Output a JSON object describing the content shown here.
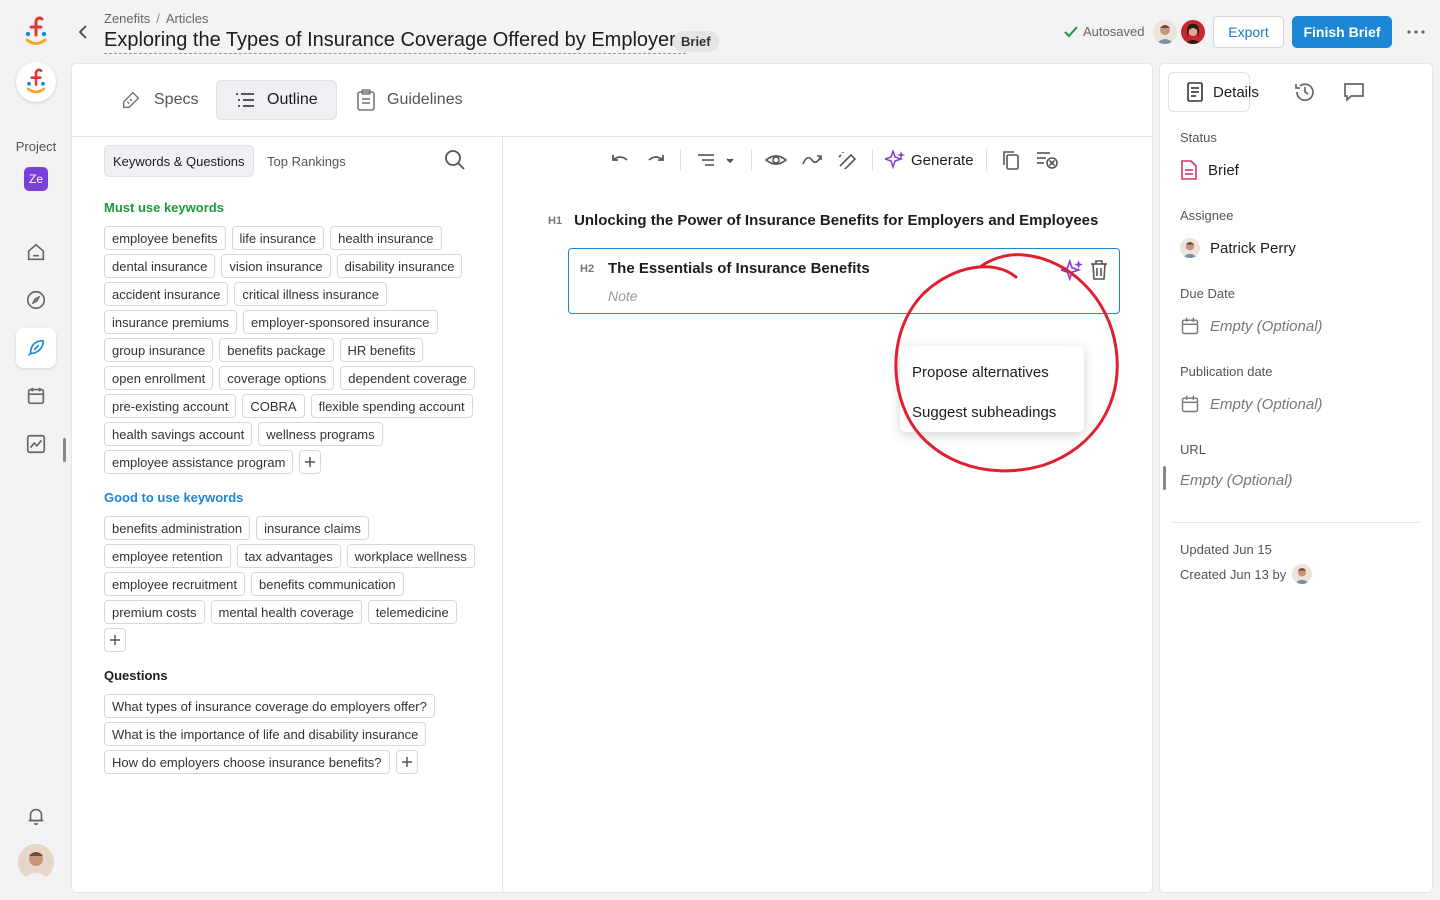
{
  "header": {
    "breadcrumb": [
      "Zenefits",
      "Articles"
    ],
    "breadcrumb_separator": "/",
    "title": "Exploring the Types of Insurance Coverage Offered by Employers",
    "title_badge": "Brief",
    "autosave_label": "Autosaved",
    "export_label": "Export",
    "finish_label": "Finish Brief"
  },
  "rail": {
    "project_label": "Project",
    "project_badge": "Ze",
    "nav_icons": [
      "home-icon",
      "compass-icon",
      "feather-icon",
      "calendar-icon",
      "analytics-icon"
    ],
    "active_nav": "feather-icon"
  },
  "tabs": [
    {
      "label": "Specs",
      "icon": "wrench-icon"
    },
    {
      "label": "Outline",
      "icon": "list-icon",
      "active": true
    },
    {
      "label": "Guidelines",
      "icon": "clipboard-icon"
    }
  ],
  "subtabs": [
    {
      "label": "Keywords & Questions",
      "active": true
    },
    {
      "label": "Top Rankings"
    }
  ],
  "keywords": {
    "must_title": "Must use keywords",
    "must": [
      "employee benefits",
      "life insurance",
      "health insurance",
      "dental insurance",
      "vision insurance",
      "disability insurance",
      "accident insurance",
      "critical illness insurance",
      "insurance premiums",
      "employer-sponsored insurance",
      "group insurance",
      "benefits package",
      "HR benefits",
      "open enrollment",
      "coverage options",
      "dependent coverage",
      "pre-existing account",
      "COBRA",
      "flexible spending account",
      "health savings account",
      "wellness programs",
      "employee assistance program"
    ],
    "good_title": "Good to use keywords",
    "good": [
      "benefits administration",
      "insurance claims",
      "employee retention",
      "tax advantages",
      "workplace wellness",
      "employee recruitment",
      "benefits communication",
      "premium costs",
      "mental health coverage",
      "telemedicine"
    ],
    "questions_title": "Questions",
    "questions": [
      "What types of insurance coverage do employers offer?",
      "What is the importance of life and disability insurance",
      "How do employers choose insurance benefits?"
    ]
  },
  "toolbar": {
    "generate_label": "Generate"
  },
  "outline": {
    "h1_tag": "H1",
    "h1_text": "Unlocking the Power of Insurance Benefits for Employers and Employees",
    "h2_tag": "H2",
    "h2_text": "The Essentials of Insurance Benefits",
    "h2_note_placeholder": "Note"
  },
  "ai_menu": {
    "items": [
      "Propose alternatives",
      "Suggest subheadings"
    ]
  },
  "details": {
    "tab_label": "Details",
    "status_label": "Status",
    "status_value": "Brief",
    "assignee_label": "Assignee",
    "assignee_value": "Patrick Perry",
    "due_label": "Due Date",
    "due_value": "Empty (Optional)",
    "pub_label": "Publication date",
    "pub_value": "Empty (Optional)",
    "url_label": "URL",
    "url_value": "Empty (Optional)",
    "updated": "Updated Jun 15",
    "created": "Created Jun 13 by"
  },
  "colors": {
    "accent": "#1b87d6",
    "must_heading": "#1a9a3e",
    "good_heading": "#1b87d6",
    "project_badge": "#7a3fd6",
    "annotation_circle": "#e02030",
    "ai_purple": "#8a3fc9"
  }
}
